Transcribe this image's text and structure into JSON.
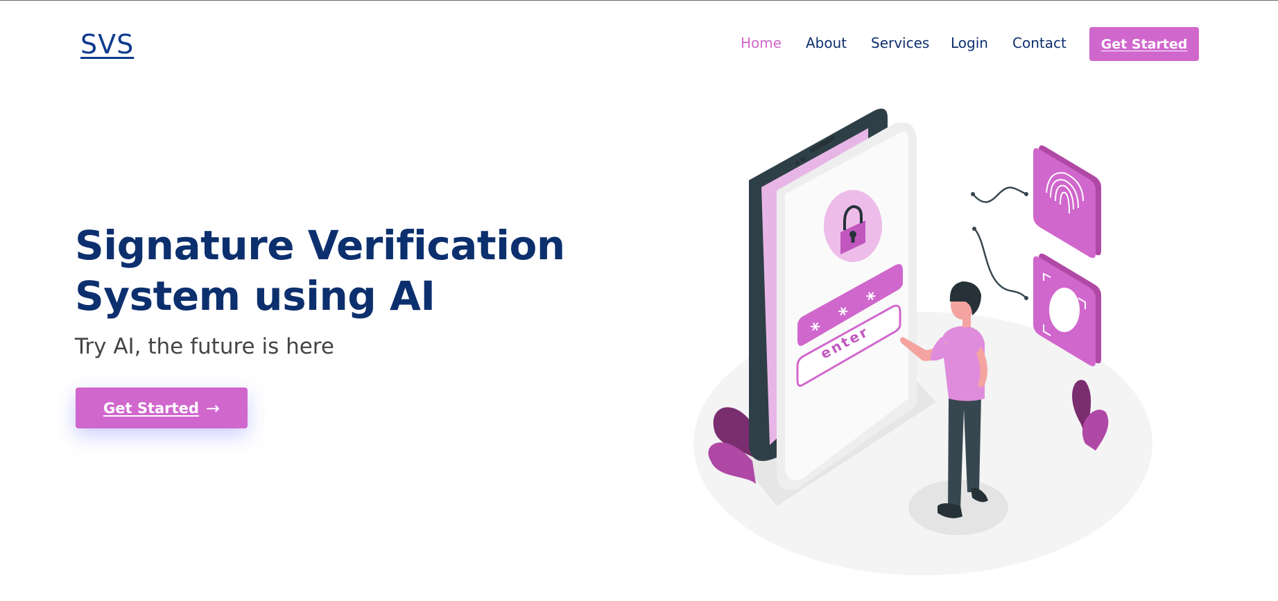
{
  "header": {
    "logo": "SVS",
    "nav": [
      {
        "label": "Home",
        "active": true
      },
      {
        "label": "About",
        "active": false
      },
      {
        "label": "Services",
        "active": false
      },
      {
        "label": "Login",
        "active": false
      },
      {
        "label": "Contact",
        "active": false
      }
    ],
    "cta_label": "Get Started"
  },
  "hero": {
    "title_line1": "Signature Verification",
    "title_line2": "System using AI",
    "subtitle": "Try AI, the future is here",
    "cta_label": "Get Started",
    "cta_icon": "arrow-right-icon"
  },
  "illustration": {
    "input_text": "enter",
    "password_mask": "* * *",
    "icons": [
      "lock-icon",
      "fingerprint-icon",
      "face-scan-icon"
    ]
  },
  "colors": {
    "accent": "#d067cd",
    "navy": "#0c2f6e",
    "text_gray": "#444444",
    "dark_slate": "#37474f"
  }
}
